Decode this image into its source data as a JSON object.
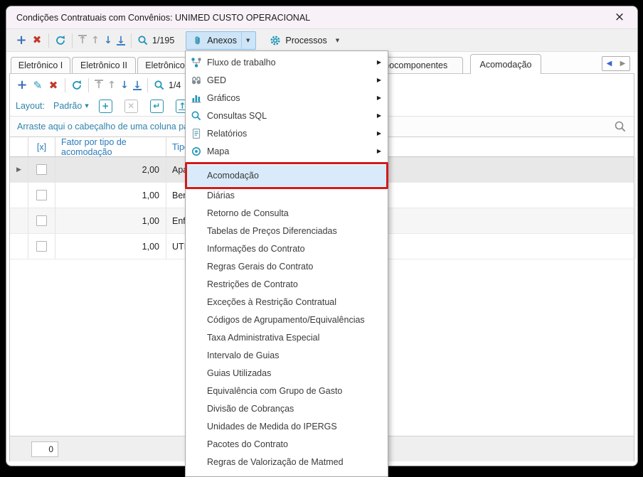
{
  "window": {
    "title": "Condições Contratuais com Convênios: UNIMED CUSTO OPERACIONAL",
    "close_glyph": "×"
  },
  "toolbar": {
    "record_counter": "1/195",
    "anexos_label": "Anexos",
    "processos_label": "Processos"
  },
  "tabs": [
    {
      "label": "Eletrônico I"
    },
    {
      "label": "Eletrônico II"
    },
    {
      "label": "Eletrônico III"
    },
    {
      "label": "Hemocomponentes"
    },
    {
      "label": "Acomodação",
      "active": true
    }
  ],
  "inner_toolbar": {
    "record_counter": "1/4"
  },
  "layout_bar": {
    "label": "Layout:",
    "preset": "Padrão"
  },
  "group_panel": {
    "hint": "Arraste aqui o cabeçalho de uma coluna para agrupar"
  },
  "grid": {
    "headers": {
      "select": "[x]",
      "fator": "Fator por tipo de acomodação",
      "tipo": "Tipo de acomodação"
    },
    "rows": [
      {
        "fator": "2,00",
        "tipo": "Apartamento"
      },
      {
        "fator": "1,00",
        "tipo": "Berçário"
      },
      {
        "fator": "1,00",
        "tipo": "Enfermaria"
      },
      {
        "fator": "1,00",
        "tipo": "UTI"
      }
    ],
    "footer_count": "0"
  },
  "menu": {
    "submenu_items": [
      {
        "label": "Fluxo de trabalho",
        "icon": "workflow-icon"
      },
      {
        "label": "GED",
        "icon": "binoculars-icon"
      },
      {
        "label": "Gráficos",
        "icon": "bar-chart-icon"
      },
      {
        "label": "Consultas SQL",
        "icon": "magnifier-icon"
      },
      {
        "label": "Relatórios",
        "icon": "document-icon"
      },
      {
        "label": "Mapa",
        "icon": "map-pin-icon"
      }
    ],
    "items": [
      {
        "label": "Acomodação",
        "highlighted": true
      },
      {
        "label": "Diárias"
      },
      {
        "label": "Retorno de Consulta"
      },
      {
        "label": "Tabelas de Preços Diferenciadas"
      },
      {
        "label": "Informações do Contrato"
      },
      {
        "label": "Regras Gerais do Contrato"
      },
      {
        "label": "Restrições de Contrato"
      },
      {
        "label": "Exceções à Restrição Contratual"
      },
      {
        "label": "Códigos de Agrupamento/Equivalências"
      },
      {
        "label": "Taxa Administrativa Especial"
      },
      {
        "label": "Intervalo de Guias"
      },
      {
        "label": "Guias Utilizadas"
      },
      {
        "label": "Equivalência com Grupo de Gasto"
      },
      {
        "label": "Divisão de Cobranças"
      },
      {
        "label": "Unidades de Medida do IPERGS"
      },
      {
        "label": "Pacotes do Contrato"
      },
      {
        "label": "Regras de Valorização de Matmed"
      }
    ]
  },
  "colors": {
    "accent_teal": "#2196b8",
    "danger_red": "#c0392b",
    "selection_blue": "#d9eafa",
    "annotation_red": "#d21b1b",
    "header_blue": "#2b7bb9",
    "titlebar_bg": "#f9f1f8"
  }
}
